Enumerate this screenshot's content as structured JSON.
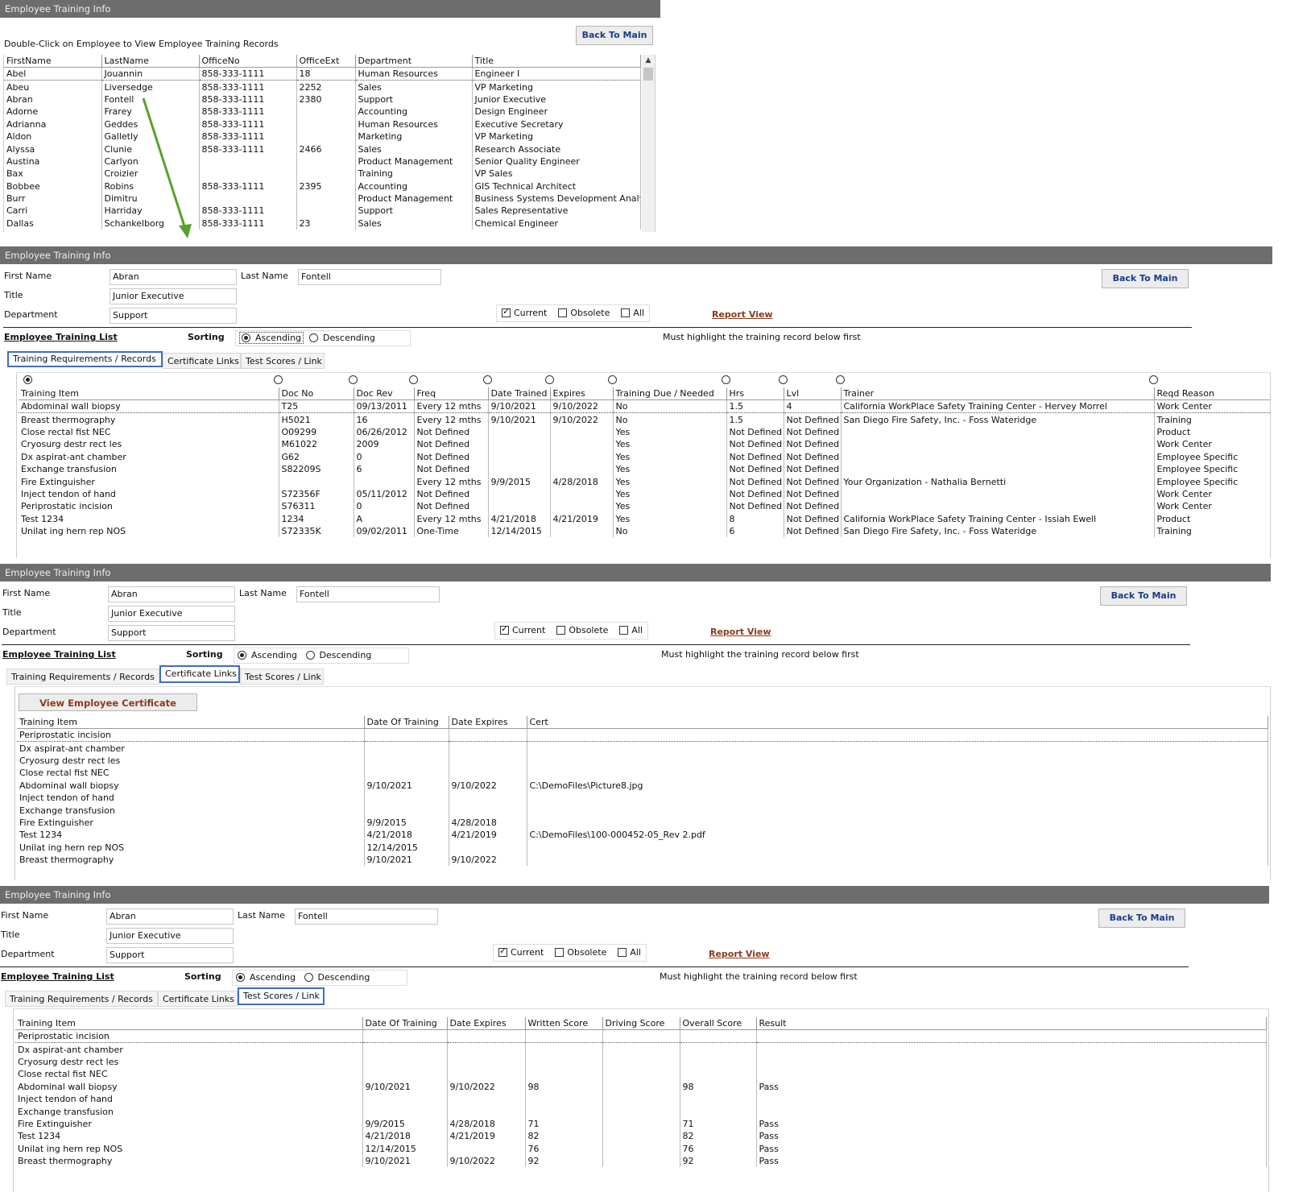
{
  "common": {
    "window_title": "Employee Training Info",
    "back_label": "Back To Main",
    "first_name_label": "First Name",
    "last_name_label": "Last Name",
    "title_label": "Title",
    "department_label": "Department",
    "first_name": "Abran",
    "last_name": "Fontell",
    "title": "Junior Executive",
    "department": "Support",
    "current_label": "Current",
    "obsolete_label": "Obsolete",
    "all_label": "All",
    "report_view": "Report View",
    "list_label": "Employee Training List",
    "sorting_label": "Sorting",
    "ascending": "Ascending",
    "descending": "Descending",
    "highlight_note": "Must highlight the training record below first",
    "tabs": [
      "Training Requirements / Records",
      "Certificate Links",
      "Test Scores / Link"
    ]
  },
  "employees": {
    "instruction": "Double-Click on Employee to View Employee Training Records",
    "columns": [
      "FirstName",
      "LastName",
      "OfficeNo",
      "OfficeExt",
      "Department",
      "Title"
    ],
    "rows": [
      [
        "Abel",
        "Jouannin",
        "858-333-1111",
        "18",
        "Human Resources",
        "Engineer I"
      ],
      [
        "Abeu",
        "Liversedge",
        "858-333-1111",
        "2252",
        "Sales",
        "VP Marketing"
      ],
      [
        "Abran",
        "Fontell",
        "858-333-1111",
        "2380",
        "Support",
        "Junior Executive"
      ],
      [
        "Adorne",
        "Frarey",
        "858-333-1111",
        "",
        "Accounting",
        "Design Engineer"
      ],
      [
        "Adrianna",
        "Geddes",
        "858-333-1111",
        "",
        "Human Resources",
        "Executive Secretary"
      ],
      [
        "Aldon",
        "Galletly",
        "858-333-1111",
        "",
        "Marketing",
        "VP Marketing"
      ],
      [
        "Alyssa",
        "Clunie",
        "858-333-1111",
        "2466",
        "Sales",
        "Research Associate"
      ],
      [
        "Austina",
        "Carlyon",
        "",
        "",
        "Product Management",
        "Senior Quality Engineer"
      ],
      [
        "Bax",
        "Croizier",
        "",
        "",
        "Training",
        "VP Sales"
      ],
      [
        "Bobbee",
        "Robins",
        "858-333-1111",
        "2395",
        "Accounting",
        "GIS Technical Architect"
      ],
      [
        "Burr",
        "Dimitru",
        "",
        "",
        "Product Management",
        "Business Systems Development Analyst"
      ],
      [
        "Carri",
        "Harriday",
        "858-333-1111",
        "",
        "Support",
        "Sales Representative"
      ],
      [
        "Dallas",
        "Schankelborg",
        "858-333-1111",
        "23",
        "Sales",
        "Chemical Engineer"
      ]
    ]
  },
  "requirements": {
    "columns": [
      "Training Item",
      "Doc No",
      "Doc Rev",
      "Freq",
      "Date Trained",
      "Expires",
      "Training Due / Needed",
      "Hrs",
      "Lvl",
      "Trainer",
      "Reqd Reason"
    ],
    "rows": [
      [
        "Abdominal wall biopsy",
        "T25",
        "09/13/2011",
        "Every 12 mths",
        "9/10/2021",
        "9/10/2022",
        "No",
        "1.5",
        "4",
        "California WorkPlace Safety Training Center - Hervey Morrel",
        "Work Center"
      ],
      [
        "Breast thermography",
        "H5021",
        "16",
        "Every 12 mths",
        "9/10/2021",
        "9/10/2022",
        "No",
        "1.5",
        "Not Defined",
        "San Diego Fire Safety, Inc. - Foss Wateridge",
        "Training"
      ],
      [
        "Close rectal fist NEC",
        "O09299",
        "06/26/2012",
        "Not Defined",
        "",
        "",
        "Yes",
        "Not Defined",
        "Not Defined",
        "",
        "Product"
      ],
      [
        "Cryosurg destr rect les",
        "M61022",
        "2009",
        "Not Defined",
        "",
        "",
        "Yes",
        "Not Defined",
        "Not Defined",
        "",
        "Work Center"
      ],
      [
        "Dx aspirat-ant chamber",
        "G62",
        "0",
        "Not Defined",
        "",
        "",
        "Yes",
        "Not Defined",
        "Not Defined",
        "",
        "Employee Specific"
      ],
      [
        "Exchange transfusion",
        "S82209S",
        "6",
        "Not Defined",
        "",
        "",
        "Yes",
        "Not Defined",
        "Not Defined",
        "",
        "Employee Specific"
      ],
      [
        "Fire Extinguisher",
        "",
        "",
        "Every 12 mths",
        "9/9/2015",
        "4/28/2018",
        "Yes",
        "Not Defined",
        "Not Defined",
        "Your Organization - Nathalia Bernetti",
        "Employee Specific"
      ],
      [
        "Inject tendon of hand",
        "S72356F",
        "05/11/2012",
        "Not Defined",
        "",
        "",
        "Yes",
        "Not Defined",
        "Not Defined",
        "",
        "Work Center"
      ],
      [
        "Periprostatic incision",
        "S76311",
        "0",
        "Not Defined",
        "",
        "",
        "Yes",
        "Not Defined",
        "Not Defined",
        "",
        "Work Center"
      ],
      [
        "Test 1234",
        "1234",
        "A",
        "Every 12 mths",
        "4/21/2018",
        "4/21/2019",
        "Yes",
        "8",
        "Not Defined",
        "California WorkPlace Safety Training Center - Issiah Ewell",
        "Product"
      ],
      [
        "Unilat ing hern rep NOS",
        "S72335K",
        "09/02/2011",
        "One-Time",
        "12/14/2015",
        "",
        "No",
        "6",
        "Not Defined",
        "San Diego Fire Safety, Inc. - Foss Wateridge",
        "Training"
      ]
    ]
  },
  "certificates": {
    "view_button": "View Employee Certificate",
    "columns": [
      "Training Item",
      "Date Of Training",
      "Date Expires",
      "Cert"
    ],
    "rows": [
      [
        "Periprostatic incision",
        "",
        "",
        ""
      ],
      [
        "Dx aspirat-ant chamber",
        "",
        "",
        ""
      ],
      [
        "Cryosurg destr rect les",
        "",
        "",
        ""
      ],
      [
        "Close rectal fist NEC",
        "",
        "",
        ""
      ],
      [
        "Abdominal wall biopsy",
        "9/10/2021",
        "9/10/2022",
        "C:\\DemoFiles\\Picture8.jpg"
      ],
      [
        "Inject tendon of hand",
        "",
        "",
        ""
      ],
      [
        "Exchange transfusion",
        "",
        "",
        ""
      ],
      [
        "Fire Extinguisher",
        "9/9/2015",
        "4/28/2018",
        ""
      ],
      [
        "Test 1234",
        "4/21/2018",
        "4/21/2019",
        "C:\\DemoFiles\\100-000452-05_Rev 2.pdf"
      ],
      [
        "Unilat ing hern rep NOS",
        "12/14/2015",
        "",
        ""
      ],
      [
        "Breast thermography",
        "9/10/2021",
        "9/10/2022",
        ""
      ]
    ]
  },
  "scores": {
    "columns": [
      "Training Item",
      "Date Of Training",
      "Date Expires",
      "Written Score",
      "Driving Score",
      "Overall Score",
      "Result"
    ],
    "rows": [
      [
        "Periprostatic incision",
        "",
        "",
        "",
        "",
        "",
        ""
      ],
      [
        "Dx aspirat-ant chamber",
        "",
        "",
        "",
        "",
        "",
        ""
      ],
      [
        "Cryosurg destr rect les",
        "",
        "",
        "",
        "",
        "",
        ""
      ],
      [
        "Close rectal fist NEC",
        "",
        "",
        "",
        "",
        "",
        ""
      ],
      [
        "Abdominal wall biopsy",
        "9/10/2021",
        "9/10/2022",
        "98",
        "",
        "98",
        "Pass"
      ],
      [
        "Inject tendon of hand",
        "",
        "",
        "",
        "",
        "",
        ""
      ],
      [
        "Exchange transfusion",
        "",
        "",
        "",
        "",
        "",
        ""
      ],
      [
        "Fire Extinguisher",
        "9/9/2015",
        "4/28/2018",
        "71",
        "",
        "71",
        "Pass"
      ],
      [
        "Test 1234",
        "4/21/2018",
        "4/21/2019",
        "82",
        "",
        "82",
        "Pass"
      ],
      [
        "Unilat ing hern rep NOS",
        "12/14/2015",
        "",
        "76",
        "",
        "76",
        "Pass"
      ],
      [
        "Breast thermography",
        "9/10/2021",
        "9/10/2022",
        "92",
        "",
        "92",
        "Pass"
      ]
    ]
  },
  "colors": {
    "titlebar": "#6d6d6d",
    "tab_highlight": "#3d6cc4",
    "arrow": "#5aa02c",
    "report_link": "#8a3b1a"
  }
}
